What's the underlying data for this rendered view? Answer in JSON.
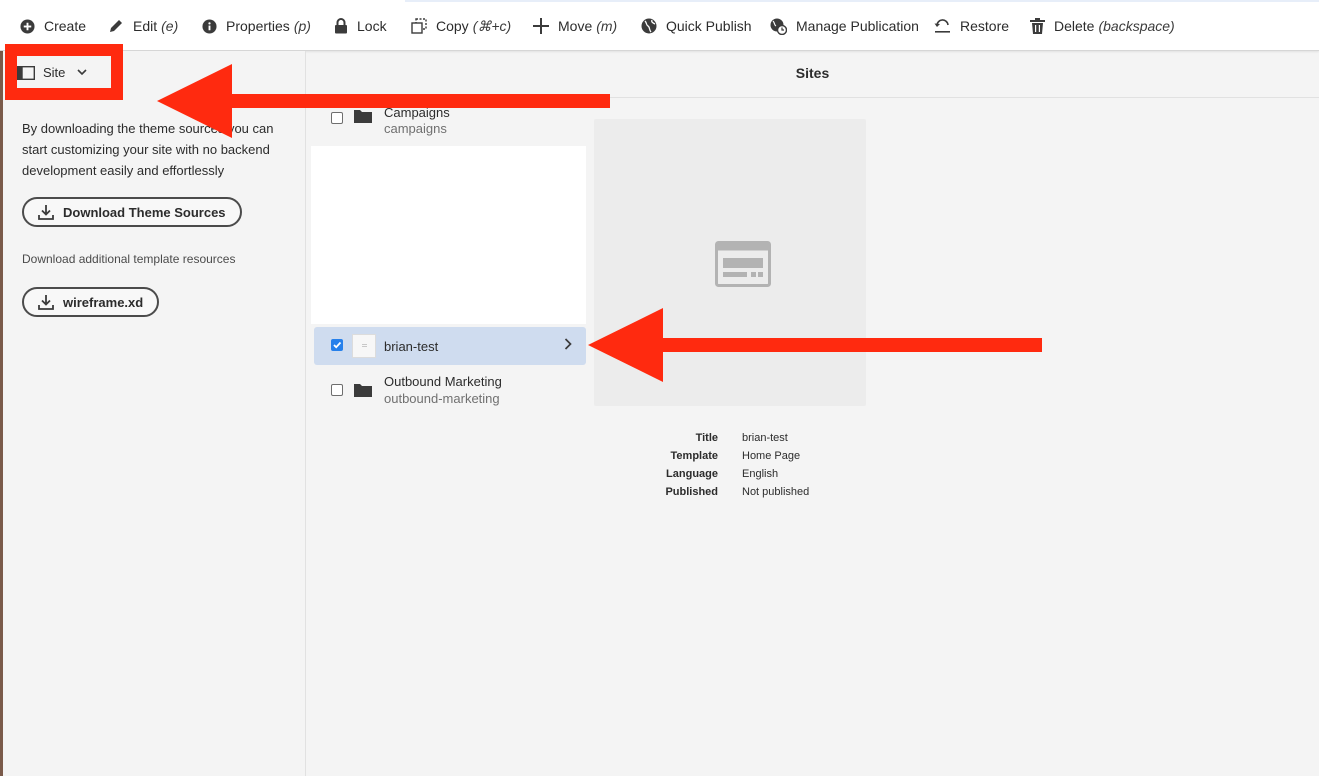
{
  "toolbar": {
    "items": [
      {
        "label": "Create",
        "shortcut": "",
        "icon": "plus-circle-icon"
      },
      {
        "label": "Edit",
        "shortcut": "(e)",
        "icon": "pencil-icon"
      },
      {
        "label": "Properties",
        "shortcut": "(p)",
        "icon": "info-icon"
      },
      {
        "label": "Lock",
        "shortcut": "",
        "icon": "lock-icon"
      },
      {
        "label": "Copy",
        "shortcut": "(⌘+c)",
        "icon": "copy-icon"
      },
      {
        "label": "Move",
        "shortcut": "(m)",
        "icon": "move-icon"
      },
      {
        "label": "Quick Publish",
        "shortcut": "",
        "icon": "globe-icon"
      },
      {
        "label": "Manage Publication",
        "shortcut": "",
        "icon": "globe-clock-icon"
      },
      {
        "label": "Restore",
        "shortcut": "",
        "icon": "restore-icon"
      },
      {
        "label": "Delete",
        "shortcut": "(backspace)",
        "icon": "trash-icon"
      }
    ]
  },
  "rail": {
    "selector_label": "Site",
    "description": "By downloading the theme sources you can start customizing your site with no backend development easily and effortlessly",
    "download_theme_label": "Download Theme Sources",
    "additional_label": "Download additional template resources",
    "wireframe_label": "wireframe.xd"
  },
  "main": {
    "title": "Sites"
  },
  "list": {
    "items": [
      {
        "name": "Campaigns",
        "path": "campaigns",
        "type": "folder",
        "checked": false
      },
      {
        "name": "brian-test",
        "path": "",
        "type": "page",
        "checked": true
      },
      {
        "name": "Outbound Marketing",
        "path": "outbound-marketing",
        "type": "folder",
        "checked": false
      }
    ]
  },
  "details": {
    "title_key": "Title",
    "title_val": "brian-test",
    "template_key": "Template",
    "template_val": "Home Page",
    "language_key": "Language",
    "language_val": "English",
    "published_key": "Published",
    "published_val": "Not published"
  },
  "colors": {
    "annotation": "#ff2a0f",
    "selection": "#cfdcef",
    "checkbox_accent": "#2680eb"
  }
}
